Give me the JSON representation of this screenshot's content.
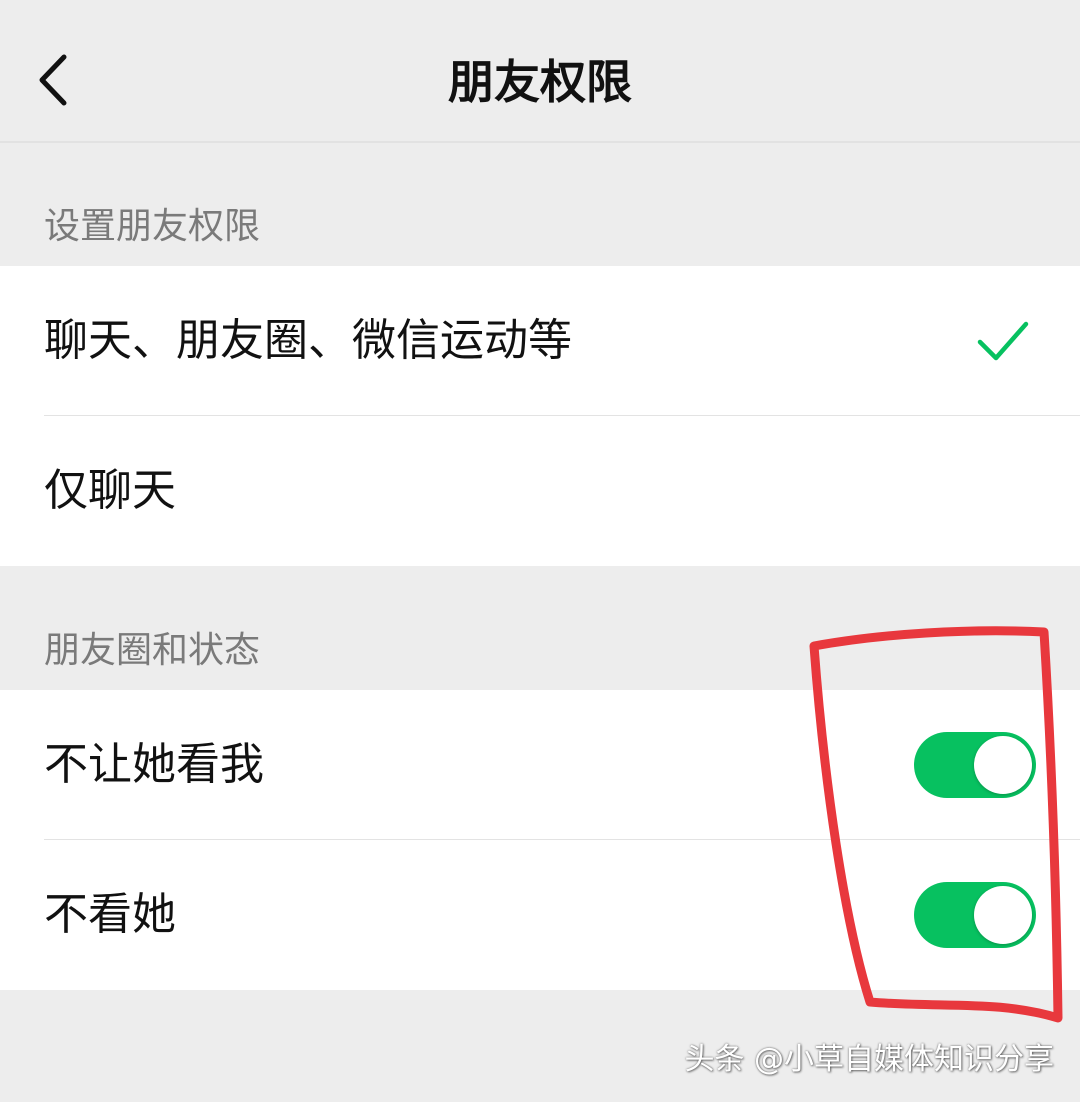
{
  "header": {
    "title": "朋友权限",
    "back_icon": "chevron-left-icon"
  },
  "permission_section": {
    "title": "设置朋友权限",
    "options": [
      {
        "label": "聊天、朋友圈、微信运动等",
        "selected": true
      },
      {
        "label": "仅聊天",
        "selected": false
      }
    ]
  },
  "moments_section": {
    "title": "朋友圈和状态",
    "toggles": [
      {
        "label": "不让她看我",
        "on": true
      },
      {
        "label": "不看她",
        "on": true
      }
    ]
  },
  "watermark": "头条 @小草自媒体知识分享",
  "colors": {
    "accent": "#07c160",
    "background": "#ededed",
    "annotation": "#e8383d"
  }
}
